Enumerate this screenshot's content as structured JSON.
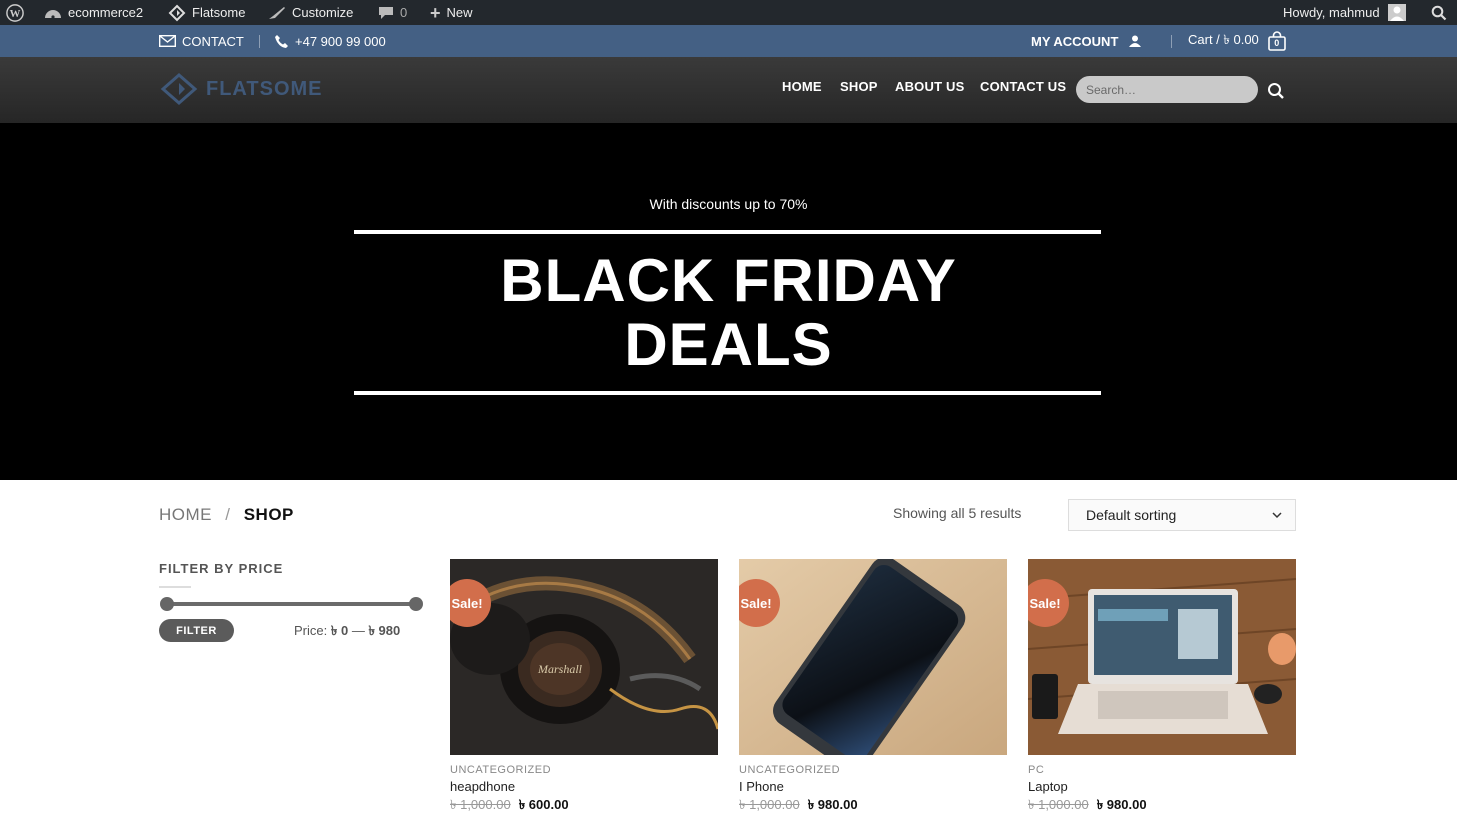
{
  "admin_bar": {
    "site_name": "ecommerce2",
    "theme": "Flatsome",
    "customize": "Customize",
    "comments": "0",
    "new": "New",
    "howdy": "Howdy, mahmud"
  },
  "top_bar": {
    "contact": "CONTACT",
    "phone": "+47 900 99 000",
    "my_account": "MY ACCOUNT",
    "cart": "Cart / ৳ 0.00",
    "cart_count": "0"
  },
  "header": {
    "logo": "FLATSOME",
    "nav": [
      "HOME",
      "SHOP",
      "ABOUT US",
      "CONTACT US"
    ],
    "search_placeholder": "Search…"
  },
  "hero": {
    "subtitle": "With discounts up to 70%",
    "title_line1": "BLACK FRIDAY",
    "title_line2": "DEALS"
  },
  "shop": {
    "breadcrumb_home": "HOME",
    "breadcrumb_sep": "/",
    "breadcrumb_current": "SHOP",
    "results": "Showing all 5 results",
    "sort": "Default sorting"
  },
  "filter": {
    "title": "FILTER BY PRICE",
    "button": "FILTER",
    "price_label": "Price:",
    "min": "৳ 0",
    "dash": "—",
    "max": "৳ 980"
  },
  "products": [
    {
      "badge": "Sale!",
      "category": "UNCATEGORIZED",
      "name": "heapdhone",
      "old_price": "৳ 1,000.00",
      "new_price": "৳ 600.00"
    },
    {
      "badge": "Sale!",
      "category": "UNCATEGORIZED",
      "name": "I Phone",
      "old_price": "৳ 1,000.00",
      "new_price": "৳ 980.00"
    },
    {
      "badge": "Sale!",
      "category": "PC",
      "name": "Laptop",
      "old_price": "৳ 1,000.00",
      "new_price": "৳ 980.00"
    }
  ],
  "colors": {
    "admin_bar": "#23282d",
    "top_bar": "#446084",
    "sale_badge": "#d26e4b"
  }
}
